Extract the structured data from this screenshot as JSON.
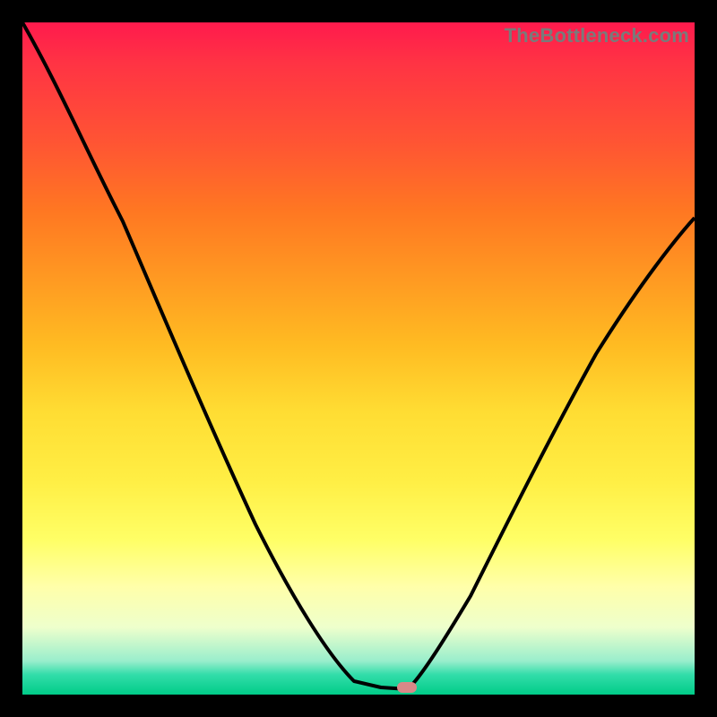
{
  "watermark": "TheBottleneck.com",
  "chart_data": {
    "type": "line",
    "title": "",
    "xlabel": "",
    "ylabel": "",
    "xlim": [
      0,
      100
    ],
    "ylim": [
      0,
      100
    ],
    "series": [
      {
        "name": "bottleneck-curve",
        "x": [
          0,
          8,
          15,
          22,
          30,
          38,
          45,
          50,
          53,
          56,
          60,
          65,
          72,
          80,
          88,
          96,
          100
        ],
        "values": [
          100,
          88,
          77,
          65,
          50,
          35,
          20,
          8,
          1,
          0,
          2,
          8,
          20,
          35,
          50,
          63,
          70
        ]
      }
    ],
    "marker": {
      "x": 56,
      "y": 0,
      "color": "#d98888"
    },
    "gradient_stops": [
      {
        "pos": 0,
        "color": "#ff1a4d"
      },
      {
        "pos": 50,
        "color": "#ffdd33"
      },
      {
        "pos": 85,
        "color": "#ffffaa"
      },
      {
        "pos": 100,
        "color": "#00cc88"
      }
    ]
  }
}
